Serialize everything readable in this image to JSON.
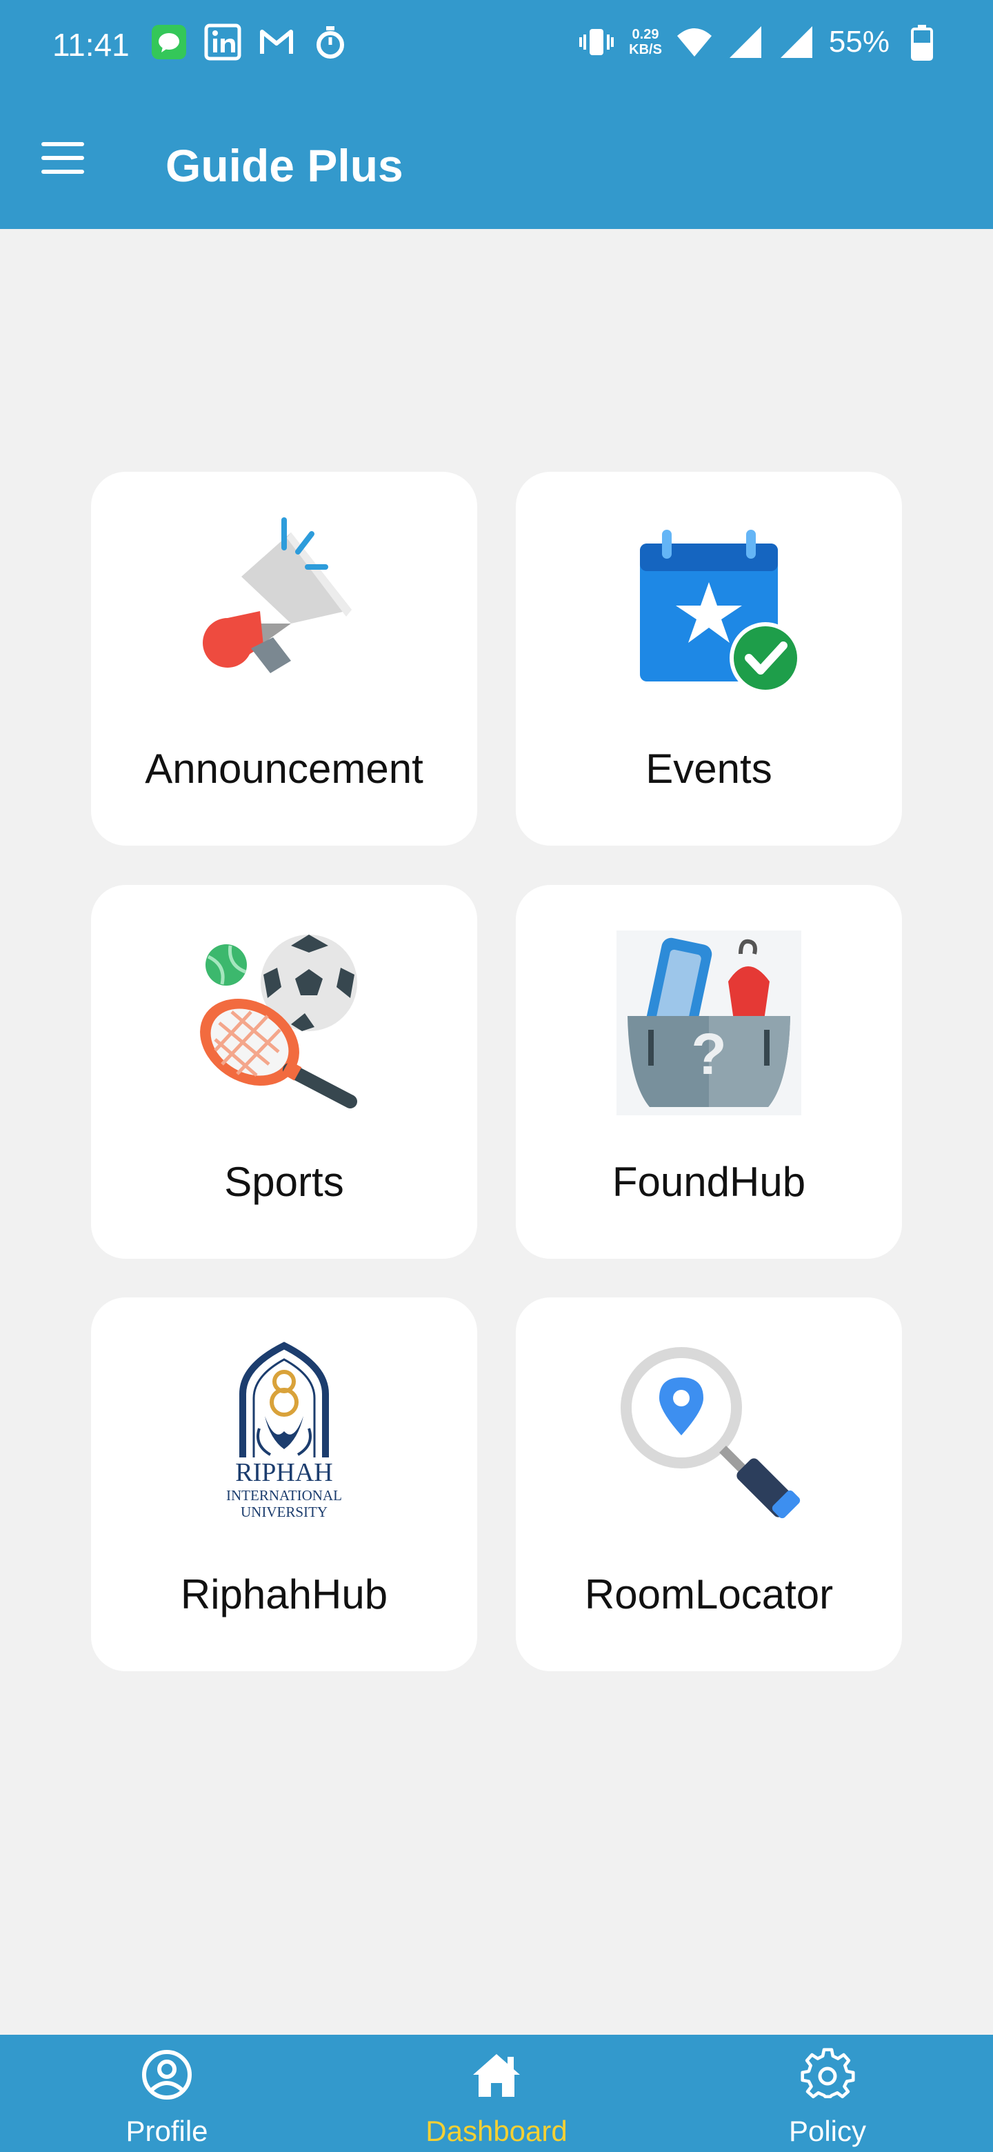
{
  "status_bar": {
    "time": "11:41",
    "net_speed_value": "0.29",
    "net_speed_unit": "KB/S",
    "battery": "55%"
  },
  "app_bar": {
    "title": "Guide Plus"
  },
  "cards": [
    {
      "label": "Announcement",
      "icon": "megaphone-icon"
    },
    {
      "label": "Events",
      "icon": "calendar-star-icon"
    },
    {
      "label": "Sports",
      "icon": "sports-equipment-icon"
    },
    {
      "label": "FoundHub",
      "icon": "lost-found-box-icon"
    },
    {
      "label": "RiphahHub",
      "icon": "riphah-logo",
      "logo_text": [
        "RIPHAH",
        "INTERNATIONAL",
        "UNIVERSITY"
      ]
    },
    {
      "label": "RoomLocator",
      "icon": "location-search-icon"
    }
  ],
  "bottom_nav": {
    "items": [
      {
        "label": "Profile",
        "icon": "profile-icon",
        "active": false
      },
      {
        "label": "Dashboard",
        "icon": "home-icon",
        "active": true
      },
      {
        "label": "Policy",
        "icon": "gear-icon",
        "active": false
      }
    ]
  },
  "colors": {
    "primary": "#3399cc",
    "background": "#f1f1f1",
    "active_nav": "#f5d033"
  }
}
